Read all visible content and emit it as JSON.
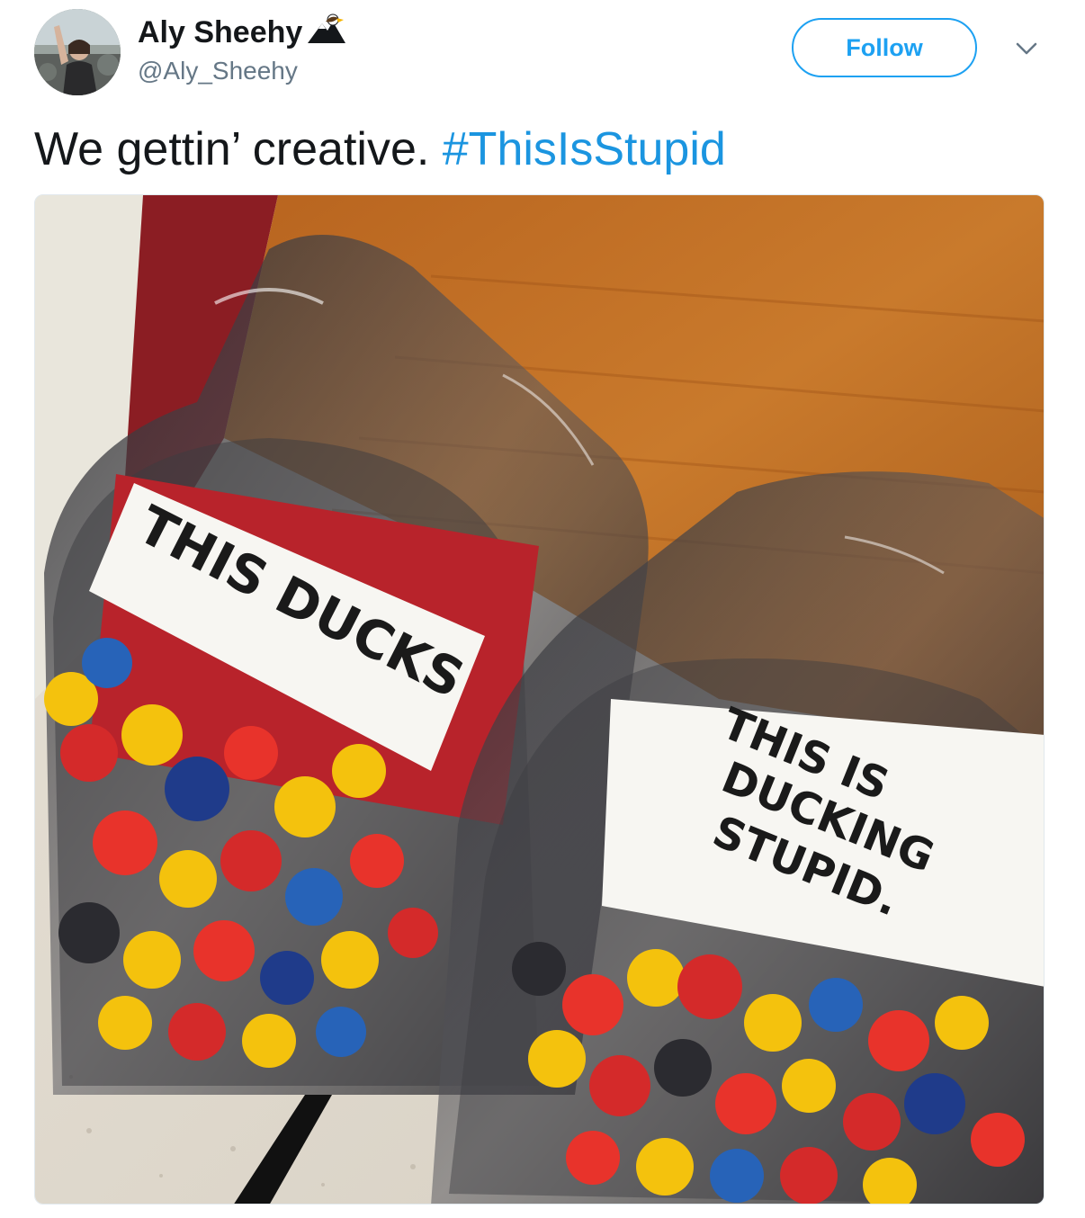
{
  "user": {
    "name": "Aly Sheehy",
    "handle": "@Aly_Sheehy",
    "badge_icon": "eagle-icon"
  },
  "follow": {
    "label": "Follow"
  },
  "menu": {
    "icon": "chevron-down-icon"
  },
  "tweet": {
    "text": "We gettin’ creative.",
    "hashtag": "#ThisIsStupid"
  },
  "photo": {
    "sign_left": "THIS DUCKS",
    "sign_right_line1": "THIS IS",
    "sign_right_line2": "DUCKING",
    "sign_right_line3": "STUPID."
  },
  "colors": {
    "accent": "#1da1f2",
    "hashtag": "#1b95e0",
    "text": "#14171a",
    "secondary": "#657786"
  }
}
